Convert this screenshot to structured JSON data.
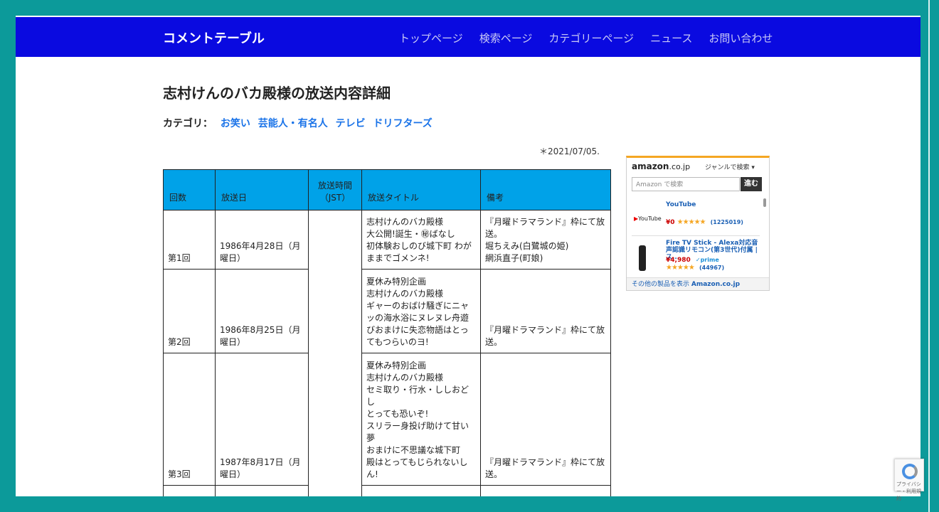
{
  "navbar": {
    "brand": "コメントテーブル",
    "items": [
      "トップページ",
      "検索ページ",
      "カテゴリーページ",
      "ニュース",
      "お問い合わせ"
    ]
  },
  "page": {
    "title": "志村けんのバカ殿様の放送内容詳細",
    "category_label": "カテゴリ：",
    "categories": [
      "お笑い",
      "芸能人・有名人",
      "テレビ",
      "ドリフターズ"
    ],
    "updated": "＊2021/07/05."
  },
  "table": {
    "headers": [
      "回数",
      "放送日",
      "放送時間\n（JST）",
      "放送タイトル",
      "備考"
    ],
    "rows": [
      {
        "num": "第1回",
        "date": "1986年4月28日（月曜日）",
        "time": "",
        "title": "志村けんのバカ殿様\n大公開!誕生・㊙ばなし\n初体験おしのび城下町 わがままでゴメンネ!",
        "note": "『月曜ドラマランド』枠にて放送。\n堀ちえみ(白鷺城の姫)\n網浜直子(町娘)"
      },
      {
        "num": "第2回",
        "date": "1986年8月25日（月曜日）",
        "time": "",
        "title": "夏休み特別企画\n志村けんのバカ殿様\nギャーのおばけ騒ぎにニャッの海水浴にヌレヌレ舟遊びおまけに失恋物語はとってもつらいのヨ!",
        "note": "『月曜ドラマランド』枠にて放送。"
      },
      {
        "num": "第3回",
        "date": "1987年8月17日（月曜日）",
        "time": "",
        "title": "夏休み特別企画\n志村けんのバカ殿様\nセミ取り・行水・ししおどし\nとっても恐いぞ!\nスリラー身投げ助けて甘い夢\nおまけに不思議な城下町\n殿はとってもじられないしん!",
        "note": "『月曜ドラマランド』枠にて放送。"
      }
    ]
  },
  "amazon": {
    "logo": "amazon",
    "logo_suffix": ".co.jp",
    "genre": "ジャンルで検索 ▾",
    "search_placeholder": "Amazon で検索",
    "go": "進む",
    "products": [
      {
        "name": "YouTube",
        "price": "¥0",
        "stars": "★★★★★",
        "reviews": "(1225019)",
        "badge": "YouTube"
      },
      {
        "name": "Fire TV Stick - Alexa対応音声認識リモコン(第3世代)付属 | ス...",
        "price": "¥4,980",
        "prime": "✓prime",
        "stars": "★★★★★",
        "reviews": "(44967)"
      }
    ],
    "more": "その他の製品を表示",
    "more_site": "Amazon.co.jp"
  },
  "recaptcha": {
    "text": "プライバシー・利用規約"
  },
  "colors": {
    "navbar": "#0a0ae0",
    "header_cell": "#00a2e8",
    "link": "#1a73e8",
    "background": "#0c9a9a"
  }
}
